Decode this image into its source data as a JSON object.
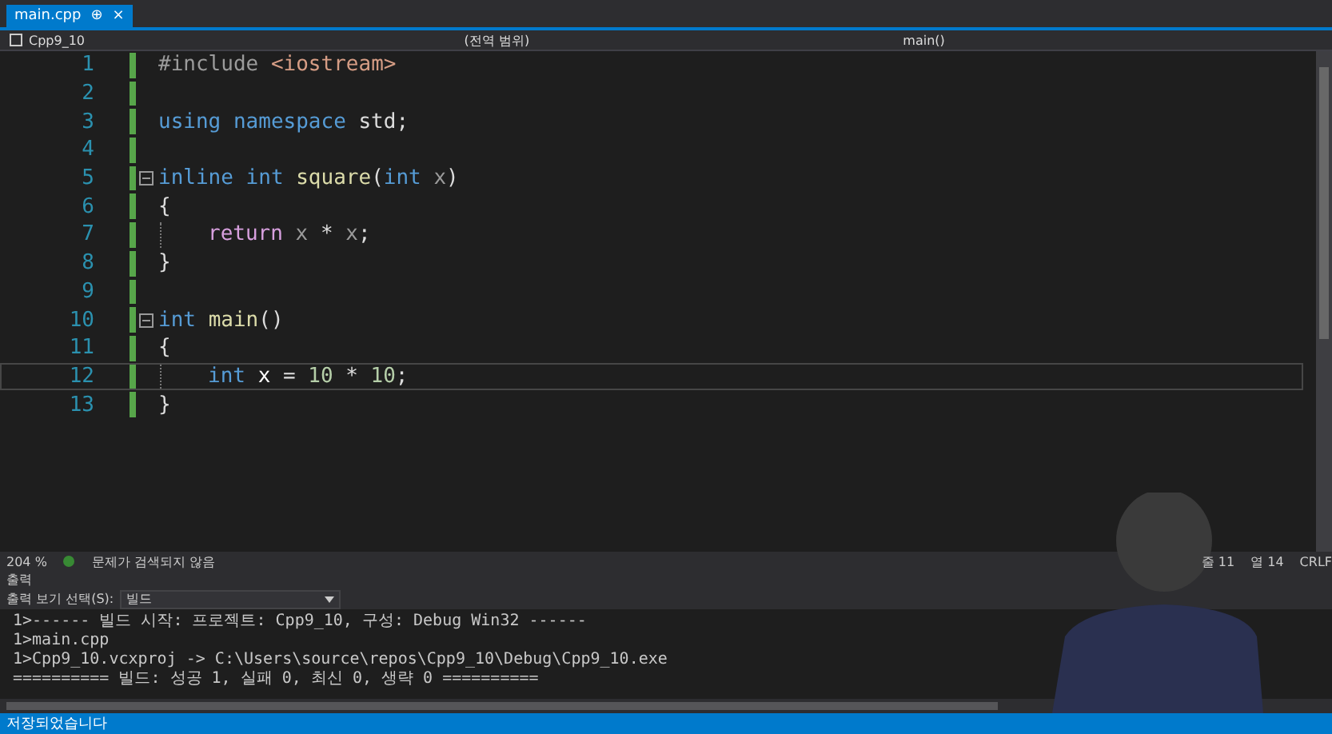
{
  "tab": {
    "label": "main.cpp",
    "pin": "⊕",
    "close": "×"
  },
  "nav": {
    "project": "Cpp9_10",
    "scope": "(전역 범위)",
    "member": "main()"
  },
  "editor": {
    "lines": [
      {
        "number": "1",
        "fold": false,
        "current": false,
        "indented": false,
        "tokens": [
          {
            "text": "#include ",
            "kind": "directive"
          },
          {
            "text": "<iostream>",
            "kind": "string"
          }
        ]
      },
      {
        "number": "2",
        "fold": false,
        "current": false,
        "indented": false
      },
      {
        "number": "3",
        "fold": false,
        "current": false,
        "indented": false,
        "tokens": [
          {
            "text": "using namespace ",
            "kind": "keyword"
          },
          {
            "text": "std;",
            "kind": "plain"
          }
        ]
      },
      {
        "number": "4",
        "fold": false,
        "current": false,
        "indented": false
      },
      {
        "number": "5",
        "fold": true,
        "current": false,
        "indented": false,
        "tokens": [
          {
            "text": "inline int ",
            "kind": "keyword"
          },
          {
            "text": "square",
            "kind": "function"
          },
          {
            "text": "(",
            "kind": "plain"
          },
          {
            "text": "int ",
            "kind": "keyword"
          },
          {
            "text": "x",
            "kind": "param"
          },
          {
            "text": ")",
            "kind": "plain"
          }
        ]
      },
      {
        "number": "6",
        "fold": false,
        "current": false,
        "indented": false,
        "tokens": [
          {
            "text": "{",
            "kind": "plain"
          }
        ]
      },
      {
        "number": "7",
        "fold": false,
        "current": false,
        "indented": true,
        "tokens": [
          {
            "text": "return ",
            "kind": "control"
          },
          {
            "text": "x",
            "kind": "param"
          },
          {
            "text": " * ",
            "kind": "plain"
          },
          {
            "text": "x",
            "kind": "param"
          },
          {
            "text": ";",
            "kind": "plain"
          }
        ]
      },
      {
        "number": "8",
        "fold": false,
        "current": false,
        "indented": false,
        "tokens": [
          {
            "text": "}",
            "kind": "plain"
          }
        ]
      },
      {
        "number": "9",
        "fold": false,
        "current": false,
        "indented": false
      },
      {
        "number": "10",
        "fold": true,
        "current": false,
        "indented": false,
        "tokens": [
          {
            "text": "int ",
            "kind": "keyword"
          },
          {
            "text": "main",
            "kind": "function"
          },
          {
            "text": "()",
            "kind": "plain"
          }
        ]
      },
      {
        "number": "11",
        "fold": false,
        "current": false,
        "indented": false,
        "tokens": [
          {
            "text": "{",
            "kind": "plain"
          }
        ]
      },
      {
        "number": "12",
        "fold": false,
        "current": true,
        "indented": true,
        "tokens": [
          {
            "text": "int ",
            "kind": "keyword"
          },
          {
            "text": "x",
            "kind": "local"
          },
          {
            "text": " = ",
            "kind": "plain"
          },
          {
            "text": "10",
            "kind": "number"
          },
          {
            "text": " * ",
            "kind": "plain"
          },
          {
            "text": "10",
            "kind": "number"
          },
          {
            "text": ";",
            "kind": "plain"
          }
        ]
      },
      {
        "number": "13",
        "fold": false,
        "current": false,
        "indented": false,
        "tokens": [
          {
            "text": "}",
            "kind": "plain"
          }
        ]
      }
    ]
  },
  "editor_status": {
    "zoom": "204 %",
    "issues": "문제가 검색되지 않음",
    "line": "줄 11",
    "column": "열 14",
    "eol": "CRLF"
  },
  "output": {
    "title": "출력",
    "source_label": "출력 보기 선택(S):",
    "source": "빌드",
    "lines": [
      "1>------ 빌드 시작: 프로젝트: Cpp9_10, 구성: Debug Win32 ------",
      "1>main.cpp",
      "1>Cpp9_10.vcxproj -> C:\\Users\\source\\repos\\Cpp9_10\\Debug\\Cpp9_10.exe",
      "========== 빌드: 성공 1, 실패 0, 최신 0, 생략 0 =========="
    ]
  },
  "status_bar": {
    "message": "저장되었습니다"
  }
}
